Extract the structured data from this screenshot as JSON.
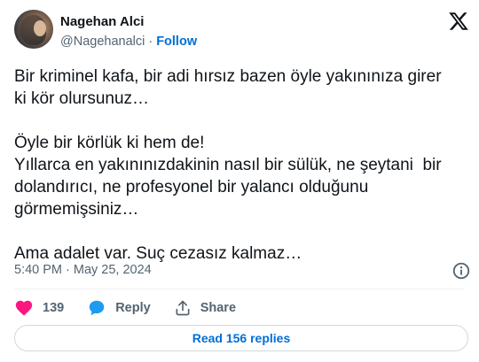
{
  "author": {
    "name": "Nagehan Alci",
    "handle": "@Nagehanalci",
    "separator": "·",
    "follow_label": "Follow"
  },
  "tweet": {
    "paragraphs": [
      [
        "Bir kriminel kafa, bir adi hırsız bazen öyle yakınınıza girer",
        "ki kör olursunuz…"
      ],
      [
        "Öyle bir körlük ki hem de!",
        "Yıllarca en yakınınızdakinin nasıl bir sülük, ne şeytani  bir",
        "dolandırıcı, ne profesyonel bir yalancı olduğunu",
        "görmemişsiniz…"
      ],
      [
        "Ama adalet var. Suç cezasız kalmaz…"
      ]
    ],
    "timestamp": "5:40 PM · May 25, 2024"
  },
  "actions": {
    "like_count": "139",
    "reply_label": "Reply",
    "share_label": "Share"
  },
  "read_replies_label": "Read 156 replies",
  "icons": {
    "logo": "x-logo-icon",
    "info": "info-icon",
    "like": "heart-icon",
    "reply": "speech-bubble-icon",
    "share": "share-icon"
  },
  "colors": {
    "link_blue": "#006fd6",
    "heart_pink": "#f91880",
    "reply_blue": "#1d9bf0",
    "secondary_text": "#536471"
  }
}
